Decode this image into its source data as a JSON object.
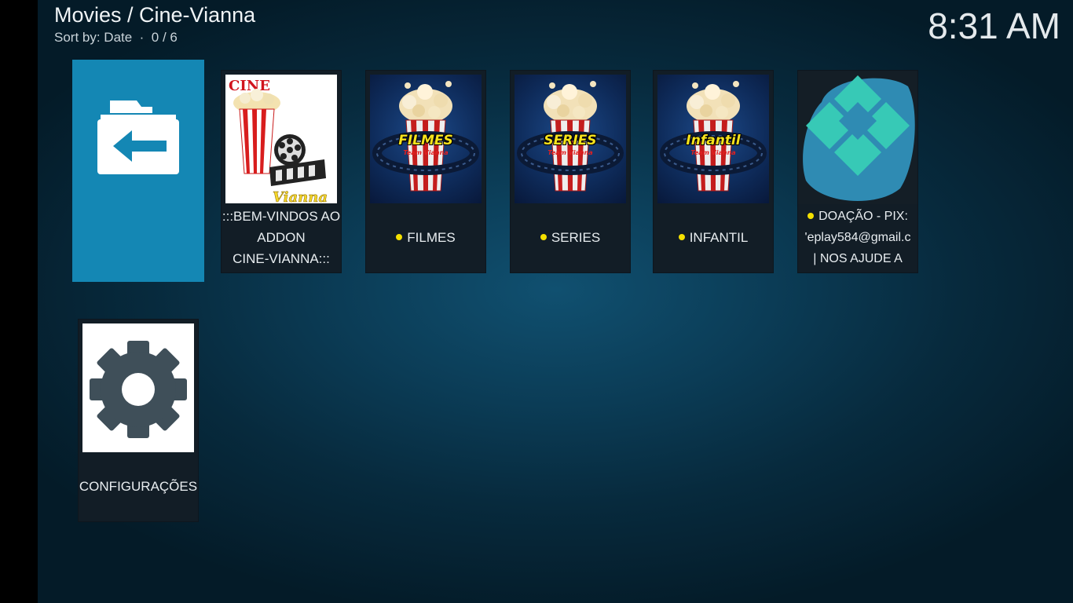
{
  "header": {
    "title": "Movies / Cine-Vianna",
    "sort_label": "Sort by: Date  ·  0 / 6",
    "clock": "8:31 AM"
  },
  "back_tile": {
    "icon": "folder-back-icon"
  },
  "items": [
    {
      "label": ":::BEM-VINDOS AO\nADDON\nCINE-VIANNA:::",
      "bullet": false,
      "thumb": "cine-vianna-logo",
      "thumb_text": "CINE",
      "thumb_text2": "Vianna"
    },
    {
      "label": "FILMES",
      "bullet": true,
      "thumb": "popcorn-filmes",
      "thumb_text": "FILMES",
      "thumb_sub": "Team Vianna"
    },
    {
      "label": "SERIES",
      "bullet": true,
      "thumb": "popcorn-series",
      "thumb_text": "SERIES",
      "thumb_sub": "Team Vianna"
    },
    {
      "label": "INFANTIL",
      "bullet": true,
      "thumb": "popcorn-infantil",
      "thumb_text": "Infantil",
      "thumb_sub": "Team Vianna"
    },
    {
      "label": "DOAÇÃO - PIX:\n'eplay584@gmail.c\n| NOS AJUDE A",
      "bullet": true,
      "thumb": "pix-logo"
    },
    {
      "label": "CONFIGURAÇÕES",
      "bullet": false,
      "thumb": "gear-icon"
    }
  ],
  "colors": {
    "accent": "#1487b4",
    "bullet": "#f4e000",
    "background": "#0b3c56"
  }
}
